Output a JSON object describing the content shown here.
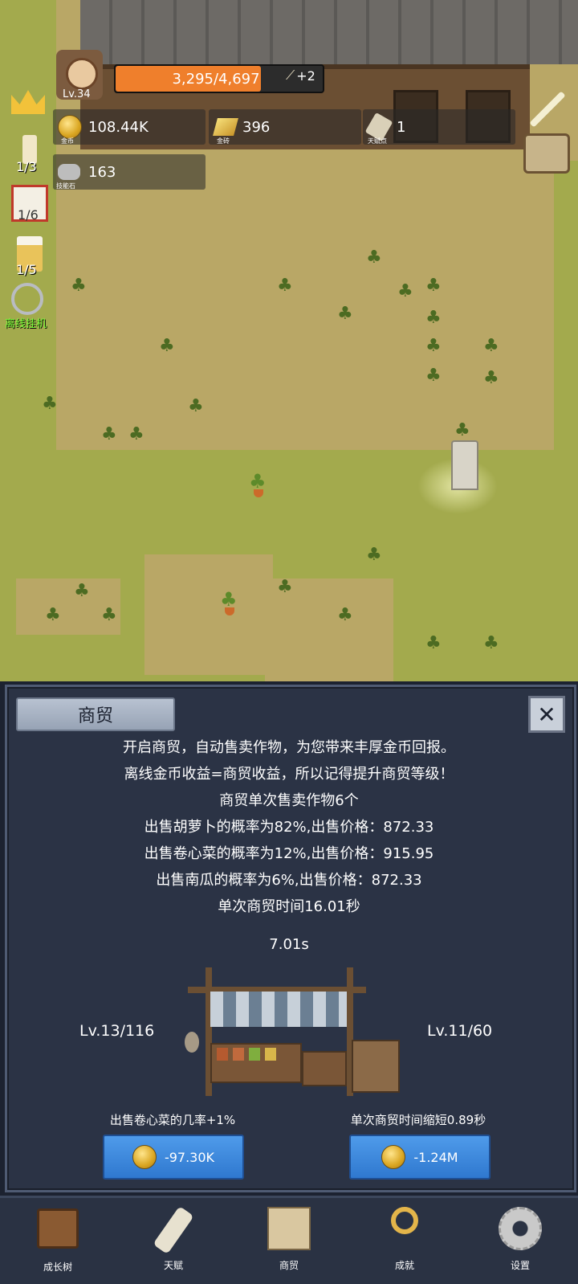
{
  "hud": {
    "level": "Lv.34",
    "exp": "3,295/4,697",
    "exp_ratio": 0.7,
    "exp_bonus": "+2",
    "gold_value": "108.44K",
    "gold_label": "金币",
    "gem_value": "396",
    "gem_label": "金砖",
    "talent_value": "1",
    "talent_label": "天赋点",
    "stone_value": "163",
    "stone_label": "技能石"
  },
  "side": {
    "candle_count": "1/3",
    "dice_count": "1/6",
    "beer_count": "1/5",
    "offline_label": "离线挂机"
  },
  "panel": {
    "title": "商贸",
    "lines": [
      "开启商贸，自动售卖作物，为您带来丰厚金币回报。",
      "离线金币收益=商贸收益，所以记得提升商贸等级！",
      "商贸单次售卖作物6个",
      "出售胡萝卜的概率为82%,出售价格：872.33",
      "出售卷心菜的概率为12%,出售价格：915.95",
      "出售南瓜的概率为6%,出售价格：872.33",
      "单次商贸时间16.01秒"
    ],
    "timer": "7.01s",
    "left_level": "Lv.13/116",
    "right_level": "Lv.11/60",
    "left_upgrade_desc": "出售卷心菜的几率+1%",
    "right_upgrade_desc": "单次商贸时间缩短0.89秒",
    "left_cost": "-97.30K",
    "right_cost": "-1.24M"
  },
  "nav": [
    "成长树",
    "天赋",
    "商贸",
    "成就",
    "设置"
  ],
  "colors": {
    "exp_bar": "#ef7f2c",
    "button": "#3a86df",
    "panel": "#2b3345"
  }
}
